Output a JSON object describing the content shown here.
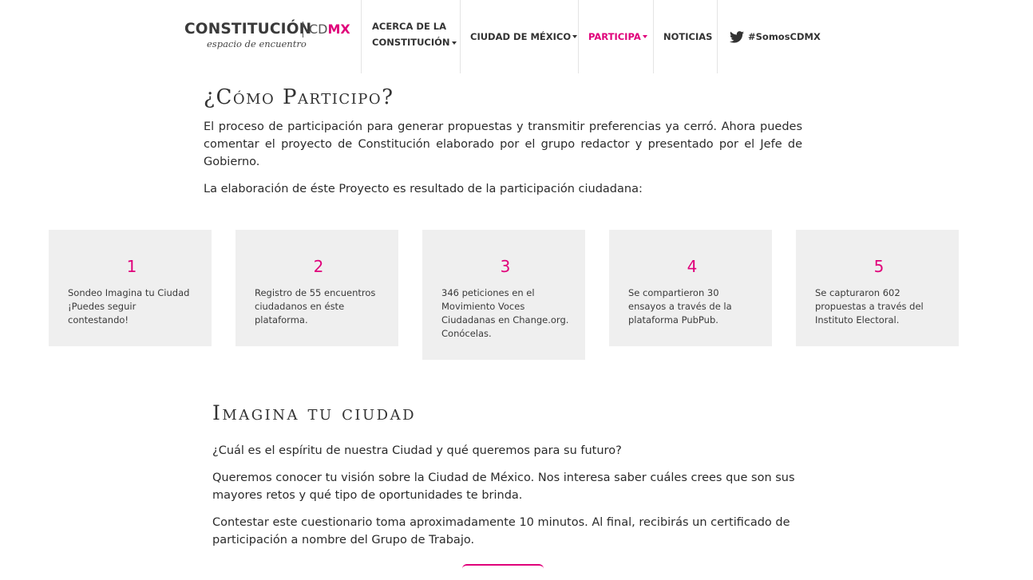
{
  "header": {
    "logo": {
      "main": "CONSTITUCIÓN",
      "cd": "CD",
      "mx": "MX",
      "subtitle": "espacio de encuentro"
    },
    "nav": [
      {
        "line1": "ACERCA DE LA",
        "line2": "CONSTITUCIÓN",
        "dropdown": true
      },
      {
        "label": "CIUDAD DE MÉXICO",
        "dropdown": true
      },
      {
        "label": "PARTICIPA",
        "dropdown": true,
        "active": true
      },
      {
        "label": "NOTICIAS",
        "dropdown": false
      },
      {
        "label": "#SomosCDMX",
        "icon": "twitter-icon"
      }
    ]
  },
  "section1": {
    "title": "¿Cómo Participo?",
    "paragraph1": "El proceso de participación para generar propuestas y transmitir preferencias ya cerró. Ahora puedes comentar el proyecto de Constitución elaborado por el grupo redactor y presentado por el Jefe de Gobierno.",
    "paragraph2": "La elaboración de éste Proyecto es resultado de la participación ciudadana:"
  },
  "cards": [
    {
      "number": "1",
      "text": "Sondeo Imagina tu Ciudad ¡Puedes seguir contestando!"
    },
    {
      "number": "2",
      "text": "Registro de 55 encuentros ciudadanos en éste plataforma."
    },
    {
      "number": "3",
      "text": "346 peticiones en el Movimiento Voces Ciudadanas en Change.org. Conócelas."
    },
    {
      "number": "4",
      "text": "Se compartieron 30 ensayos a través de la plataforma PubPub."
    },
    {
      "number": "5",
      "text": "Se capturaron 602 propuestas a través del Instituto Electoral."
    }
  ],
  "section2": {
    "title": "Imagina tu ciudad",
    "paragraph1": "¿Cuál es el espíritu de nuestra Ciudad y qué queremos para su futuro?",
    "paragraph2": "Queremos conocer tu visión sobre la Ciudad de México. Nos interesa saber cuáles crees que son sus mayores retos y qué tipo de oportunidades te brinda.",
    "paragraph3": "Contestar este cuestionario toma aproximadamente 10 minutos. Al final, recibirás un certificado de participación a nombre del Grupo de Trabajo."
  },
  "colors": {
    "accent": "#e0007a",
    "card_bg": "#efefef",
    "text": "#2b2b2b"
  }
}
